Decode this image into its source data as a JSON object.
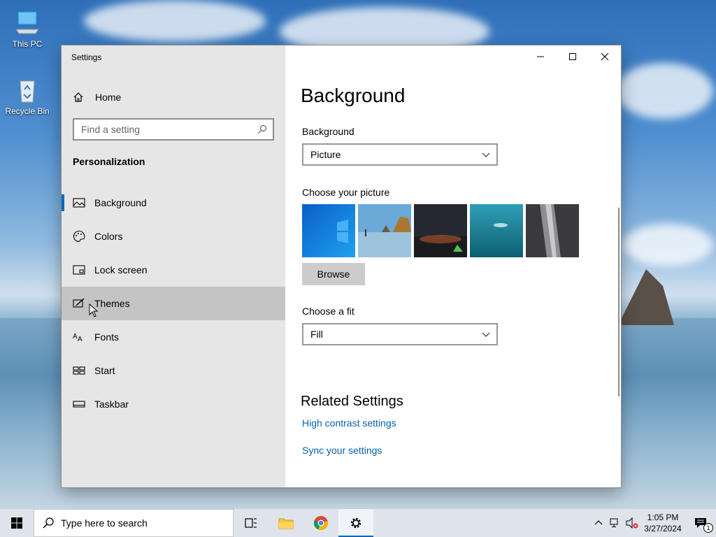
{
  "desktop": {
    "icons": [
      {
        "label": "This PC"
      },
      {
        "label": "Recycle Bin"
      }
    ]
  },
  "window": {
    "title": "Settings",
    "controls": {
      "minimize": "minimize-icon",
      "maximize": "maximize-icon",
      "close": "close-icon"
    }
  },
  "sidebar": {
    "home_label": "Home",
    "search_placeholder": "Find a setting",
    "section_title": "Personalization",
    "items": [
      {
        "label": "Background",
        "icon": "picture-icon",
        "selected": true
      },
      {
        "label": "Colors",
        "icon": "palette-icon"
      },
      {
        "label": "Lock screen",
        "icon": "lock-screen-icon"
      },
      {
        "label": "Themes",
        "icon": "themes-icon",
        "hover": true
      },
      {
        "label": "Fonts",
        "icon": "fonts-icon"
      },
      {
        "label": "Start",
        "icon": "start-icon"
      },
      {
        "label": "Taskbar",
        "icon": "taskbar-icon"
      }
    ]
  },
  "main": {
    "title": "Background",
    "background_label": "Background",
    "background_value": "Picture",
    "choose_picture_label": "Choose your picture",
    "browse_label": "Browse",
    "fit_label": "Choose a fit",
    "fit_value": "Fill",
    "related_title": "Related Settings",
    "links": [
      "High contrast settings",
      "Sync your settings"
    ]
  },
  "taskbar": {
    "search_placeholder": "Type here to search",
    "time": "1:05 PM",
    "date": "3/27/2024",
    "notification_count": "1"
  },
  "colors": {
    "accent": "#0067c0",
    "link": "#0063b1",
    "sidebar_bg": "#e6e6e6"
  }
}
